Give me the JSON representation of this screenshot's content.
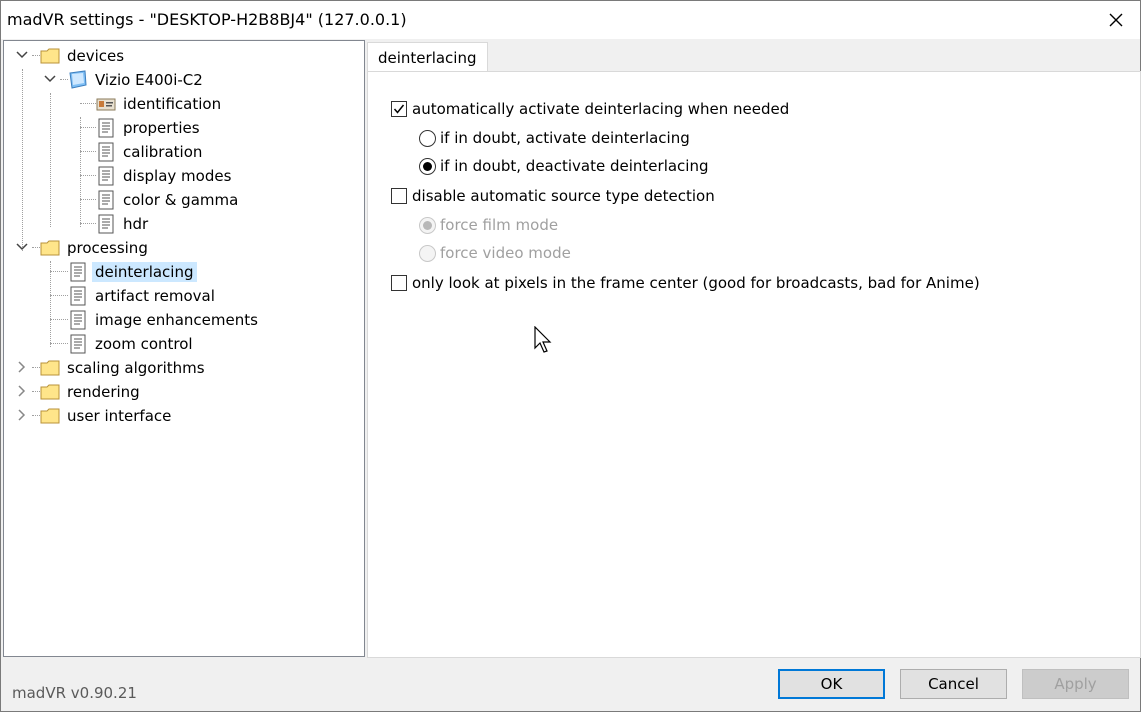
{
  "window": {
    "title": "madVR settings - \"DESKTOP-H2B8BJ4\" (127.0.0.1)"
  },
  "tree": {
    "devices": "devices",
    "device_name": "Vizio E400i-C2",
    "device_items": [
      "identification",
      "properties",
      "calibration",
      "display modes",
      "color & gamma",
      "hdr"
    ],
    "processing": "processing",
    "processing_items": [
      "deinterlacing",
      "artifact removal",
      "image enhancements",
      "zoom control"
    ],
    "collapsed_folders": [
      "scaling algorithms",
      "rendering",
      "user interface"
    ],
    "selected": "deinterlacing"
  },
  "tab": {
    "label": "deinterlacing"
  },
  "options": {
    "auto_activate": {
      "label": "automatically activate deinterlacing when needed",
      "checked": true
    },
    "doubt_activate": {
      "label": "if in doubt, activate deinterlacing",
      "selected": false
    },
    "doubt_deactivate": {
      "label": "if in doubt, deactivate deinterlacing",
      "selected": true
    },
    "disable_detection": {
      "label": "disable automatic source type detection",
      "checked": false
    },
    "force_film": {
      "label": "force film mode",
      "selected": true,
      "enabled": false
    },
    "force_video": {
      "label": "force video mode",
      "selected": false,
      "enabled": false
    },
    "frame_center": {
      "label": "only look at pixels in the frame center  (good for broadcasts, bad for Anime)",
      "checked": false
    }
  },
  "footer": {
    "version": "madVR v0.90.21",
    "ok_label": "OK",
    "cancel_label": "Cancel",
    "apply_label": "Apply"
  },
  "colors": {
    "selection": "#cce8ff",
    "default_button_border": "#0078d7",
    "folder": "#ffe58a",
    "disabled_text": "#a0a0a0"
  },
  "icons": {
    "folder": "folder-icon",
    "monitor": "monitor-icon",
    "identification": "id-card-icon",
    "page": "page-icon",
    "close": "close-icon",
    "expand": "chevron-down-icon",
    "collapse": "chevron-right-icon",
    "check": "check-icon"
  }
}
